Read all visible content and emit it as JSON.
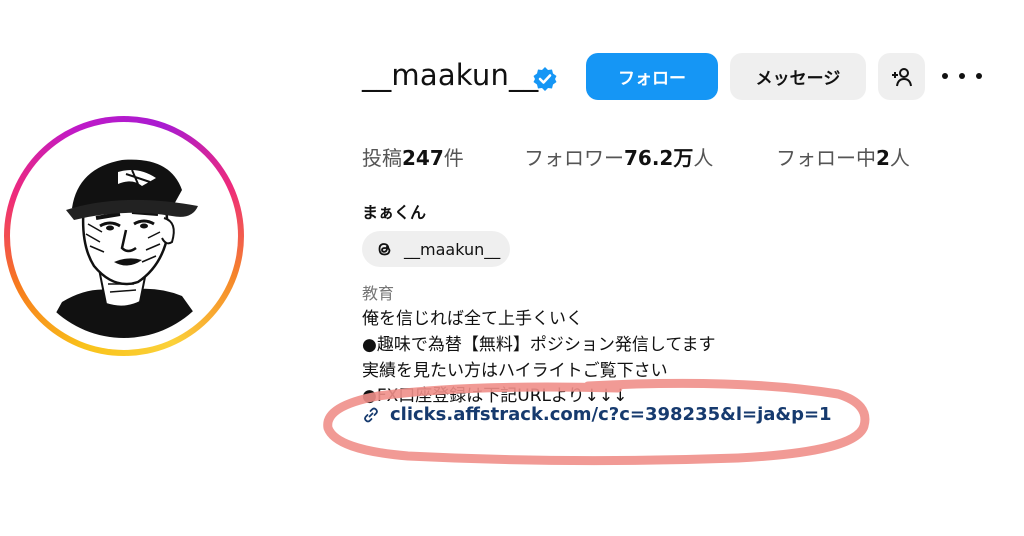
{
  "profile": {
    "username": "__maakun__",
    "verified_icon": "verified-badge-icon",
    "display_name": "まぁくん",
    "threads_handle": "__maakun__",
    "category": "教育",
    "bio_lines": [
      "俺を信じれば全て上手くいく",
      "●趣味で為替【無料】ポジション発信してます",
      "実績を見たい方はハイライトご覧下さい",
      "●FX口座登録は下記URLより↓↓↓"
    ],
    "link": "clicks.affstrack.com/c?c=398235&l=ja&p=1"
  },
  "actions": {
    "follow_label": "フォロー",
    "message_label": "メッセージ",
    "add_user_icon": "add-person-icon",
    "more_icon": "more-options-icon"
  },
  "stats": {
    "posts_label": "投稿",
    "posts_value": "247",
    "posts_unit": "件",
    "followers_label": "フォロワー",
    "followers_value": "76.2万",
    "followers_unit": "人",
    "following_label": "フォロー中",
    "following_value": "2",
    "following_unit": "人"
  },
  "colors": {
    "accent": "#1596f5",
    "button_gray": "#efefef",
    "link": "#163a6e",
    "annotation": "#ef8f8a"
  }
}
